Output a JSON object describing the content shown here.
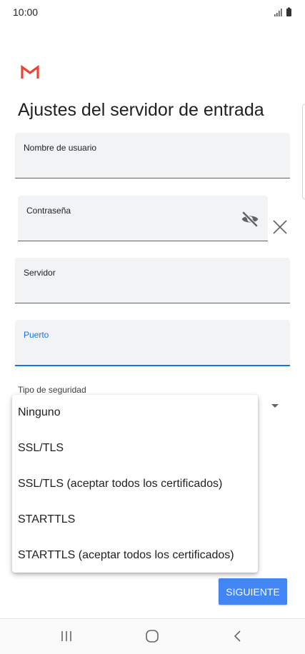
{
  "status_bar": {
    "time": "10:00",
    "signal_icon": "signal-bars-icon",
    "battery_icon": "battery-icon"
  },
  "app": {
    "logo_icon": "gmail-logo",
    "brand_color": "#ea4335",
    "title": "Ajustes del servidor de entrada"
  },
  "form": {
    "username": {
      "label": "Nombre de usuario",
      "value": ""
    },
    "password": {
      "label": "Contraseña",
      "value": "",
      "visibility_icon": "visibility-off-icon",
      "clear_icon": "close-icon"
    },
    "server": {
      "label": "Servidor",
      "value": ""
    },
    "port": {
      "label": "Puerto",
      "value": "",
      "focused": true
    },
    "security": {
      "label": "Tipo de seguridad"
    }
  },
  "security_options": [
    "Ninguno",
    "SSL/TLS",
    "SSL/TLS (aceptar todos los certificados)",
    "STARTTLS",
    "STARTTLS (aceptar todos los certificados)"
  ],
  "actions": {
    "next_label": "SIGUIENTE",
    "accent_color": "#4285f4",
    "focus_color": "#1a73e8"
  },
  "nav_bar": {
    "recents_icon": "recents-icon",
    "home_icon": "home-icon",
    "back_icon": "back-icon"
  }
}
